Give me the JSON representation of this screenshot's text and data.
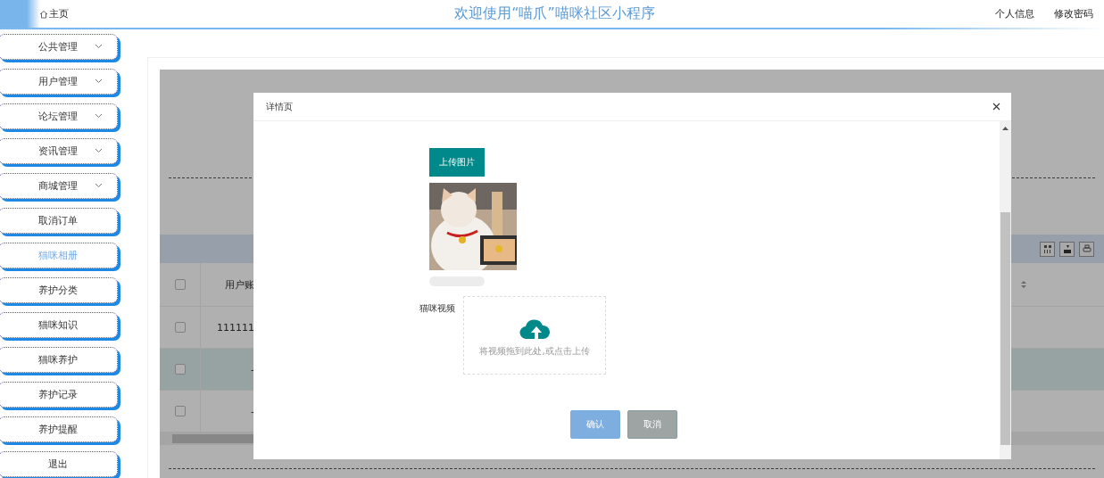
{
  "header": {
    "home": "主页",
    "title": "欢迎使用“喵爪”喵咪社区小程序",
    "links": [
      "个人信息",
      "修改密码"
    ]
  },
  "sidebar": {
    "items": [
      {
        "label": "公共管理",
        "kind": "group",
        "selected": false
      },
      {
        "label": "用户管理",
        "kind": "group",
        "selected": false
      },
      {
        "label": "论坛管理",
        "kind": "group",
        "selected": false
      },
      {
        "label": "资讯管理",
        "kind": "group",
        "selected": false
      },
      {
        "label": "商城管理",
        "kind": "group",
        "selected": false
      },
      {
        "label": "取消订单",
        "kind": "link",
        "selected": false
      },
      {
        "label": "猫咪相册",
        "kind": "link",
        "selected": true
      },
      {
        "label": "养护分类",
        "kind": "link",
        "selected": false
      },
      {
        "label": "猫咪知识",
        "kind": "link",
        "selected": false
      },
      {
        "label": "猫咪养护",
        "kind": "link",
        "selected": false
      },
      {
        "label": "养护记录",
        "kind": "link",
        "selected": false
      },
      {
        "label": "养护提醒",
        "kind": "link",
        "selected": false
      },
      {
        "label": "退出",
        "kind": "link",
        "selected": false
      }
    ]
  },
  "table": {
    "columns": [
      "用户账"
    ],
    "header_checked": false,
    "rows": [
      {
        "cells": [
          "111111"
        ],
        "checked": false,
        "selected": false
      },
      {
        "cells": [
          "-"
        ],
        "checked": false,
        "selected": true
      },
      {
        "cells": [
          "-"
        ],
        "checked": false,
        "selected": false
      }
    ]
  },
  "dialog": {
    "title": "详情页",
    "upload_button": "上传图片",
    "video_label": "猫咪视频",
    "dropzone_hint": "将视频拖到此处,或点击上传",
    "buttons": [
      {
        "label": "确认",
        "kind": "primary"
      },
      {
        "label": "取消",
        "kind": "secondary"
      }
    ]
  }
}
